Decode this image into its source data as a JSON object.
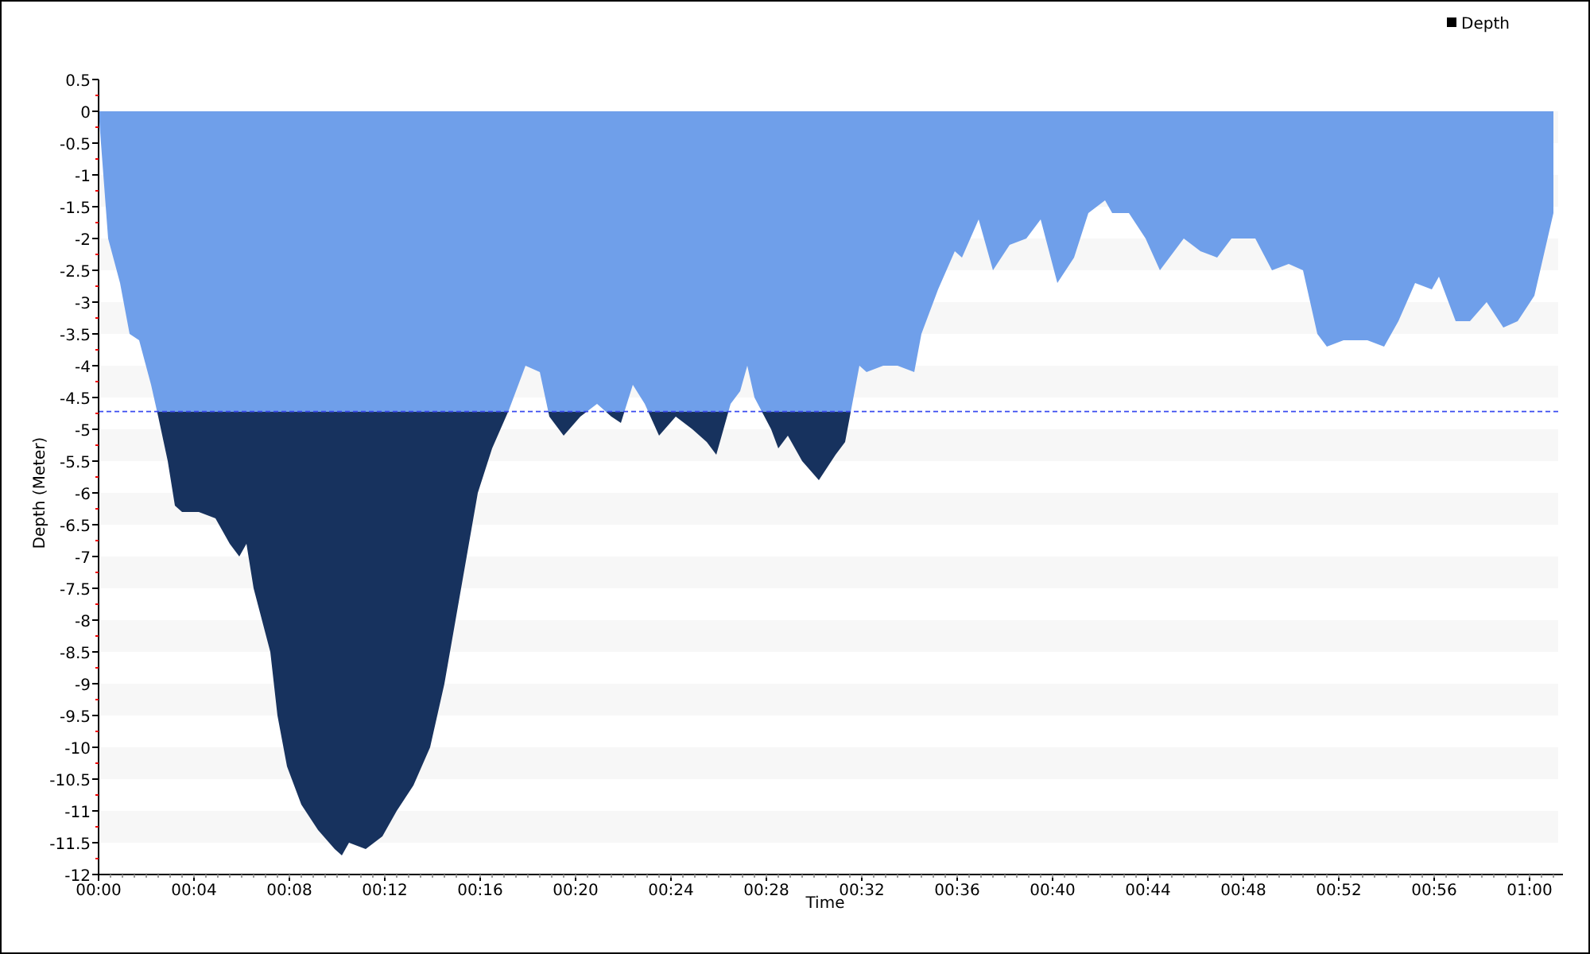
{
  "chart": {
    "chart_data": {
      "type": "area",
      "xlabel": "Time",
      "ylabel": "Depth (Meter)",
      "x": [
        0,
        0.2,
        0.4,
        0.9,
        1.3,
        1.7,
        2.2,
        2.5,
        2.9,
        3.2,
        3.5,
        4.2,
        4.9,
        5.5,
        5.9,
        6.2,
        6.5,
        7.2,
        7.5,
        7.9,
        8.5,
        9.2,
        9.9,
        10.2,
        10.5,
        11.2,
        11.9,
        12.5,
        13.2,
        13.9,
        14.5,
        15.2,
        15.9,
        16.5,
        17.2,
        17.9,
        18.5,
        18.9,
        19.5,
        20.2,
        20.9,
        21.5,
        21.9,
        22.4,
        22.9,
        23.5,
        24.2,
        24.9,
        25.5,
        25.9,
        26.5,
        26.9,
        27.2,
        27.5,
        28.2,
        28.5,
        28.9,
        29.5,
        30.2,
        30.9,
        31.3,
        31.9,
        32.2,
        32.9,
        33.5,
        34.2,
        34.5,
        35.2,
        35.9,
        36.2,
        36.9,
        37.5,
        38.2,
        38.9,
        39.5,
        40.2,
        40.9,
        41.5,
        42.2,
        42.5,
        43.2,
        43.9,
        44.5,
        45.5,
        46.2,
        46.9,
        47.5,
        48.5,
        49.2,
        49.9,
        50.5,
        51.1,
        51.5,
        52.2,
        53.2,
        53.9,
        54.5,
        55.2,
        55.9,
        56.2,
        56.9,
        57.5,
        58.2,
        58.9,
        59.5,
        60.2,
        61
      ],
      "series": [
        {
          "name": "Depth",
          "color": "#6f9fea",
          "values": [
            0,
            -1,
            -2,
            -2.7,
            -3.5,
            -3.6,
            -4.3,
            -4.8,
            -5.5,
            -6.2,
            -6.3,
            -6.3,
            -6.4,
            -6.8,
            -7,
            -6.8,
            -7.5,
            -8.5,
            -9.5,
            -10.3,
            -10.9,
            -11.3,
            -11.6,
            -11.7,
            -11.5,
            -11.6,
            -11.4,
            -11,
            -10.6,
            -10,
            -9,
            -7.5,
            -6,
            -5.3,
            -4.7,
            -4,
            -4.1,
            -4.8,
            -5.1,
            -4.8,
            -4.6,
            -4.8,
            -4.9,
            -4.3,
            -4.6,
            -5.1,
            -4.8,
            -5,
            -5.2,
            -5.4,
            -4.6,
            -4.4,
            -4,
            -4.5,
            -5,
            -5.3,
            -5.1,
            -5.5,
            -5.8,
            -5.4,
            -5.2,
            -4,
            -4.1,
            -4,
            -4,
            -4.1,
            -3.5,
            -2.8,
            -2.2,
            -2.3,
            -1.7,
            -2.5,
            -2.1,
            -2,
            -1.7,
            -2.7,
            -2.3,
            -1.6,
            -1.4,
            -1.6,
            -1.6,
            -2,
            -2.5,
            -2,
            -2.2,
            -2.3,
            -2,
            -2,
            -2.5,
            -2.4,
            -2.5,
            -3.5,
            -3.7,
            -3.6,
            -3.6,
            -3.7,
            -3.3,
            -2.7,
            -2.8,
            -2.6,
            -3.3,
            -3.3,
            -3,
            -3.4,
            -3.3,
            -2.9,
            -1.6
          ]
        }
      ],
      "xlim": [
        0,
        61.2
      ],
      "ylim": [
        -12,
        0.5
      ],
      "xticks": [
        {
          "value": 0,
          "label": "00:00"
        },
        {
          "value": 4,
          "label": "00:04"
        },
        {
          "value": 8,
          "label": "00:08"
        },
        {
          "value": 12,
          "label": "00:12"
        },
        {
          "value": 16,
          "label": "00:16"
        },
        {
          "value": 20,
          "label": "00:20"
        },
        {
          "value": 24,
          "label": "00:24"
        },
        {
          "value": 28,
          "label": "00:28"
        },
        {
          "value": 32,
          "label": "00:32"
        },
        {
          "value": 36,
          "label": "00:36"
        },
        {
          "value": 40,
          "label": "00:40"
        },
        {
          "value": 44,
          "label": "00:44"
        },
        {
          "value": 48,
          "label": "00:48"
        },
        {
          "value": 52,
          "label": "00:52"
        },
        {
          "value": 56,
          "label": "00:56"
        },
        {
          "value": 60,
          "label": "01:00"
        }
      ],
      "yticks": [
        0.5,
        0,
        -0.5,
        -1,
        -1.5,
        -2,
        -2.5,
        -3,
        -3.5,
        -4,
        -4.5,
        -5,
        -5.5,
        -6,
        -6.5,
        -7,
        -7.5,
        -8,
        -8.5,
        -9,
        -9.5,
        -10,
        -10.5,
        -11,
        -11.5,
        -12
      ],
      "ref_lines": [
        {
          "axis": "y",
          "value": -4.72,
          "color": "#3b4cf0"
        }
      ]
    }
  }
}
